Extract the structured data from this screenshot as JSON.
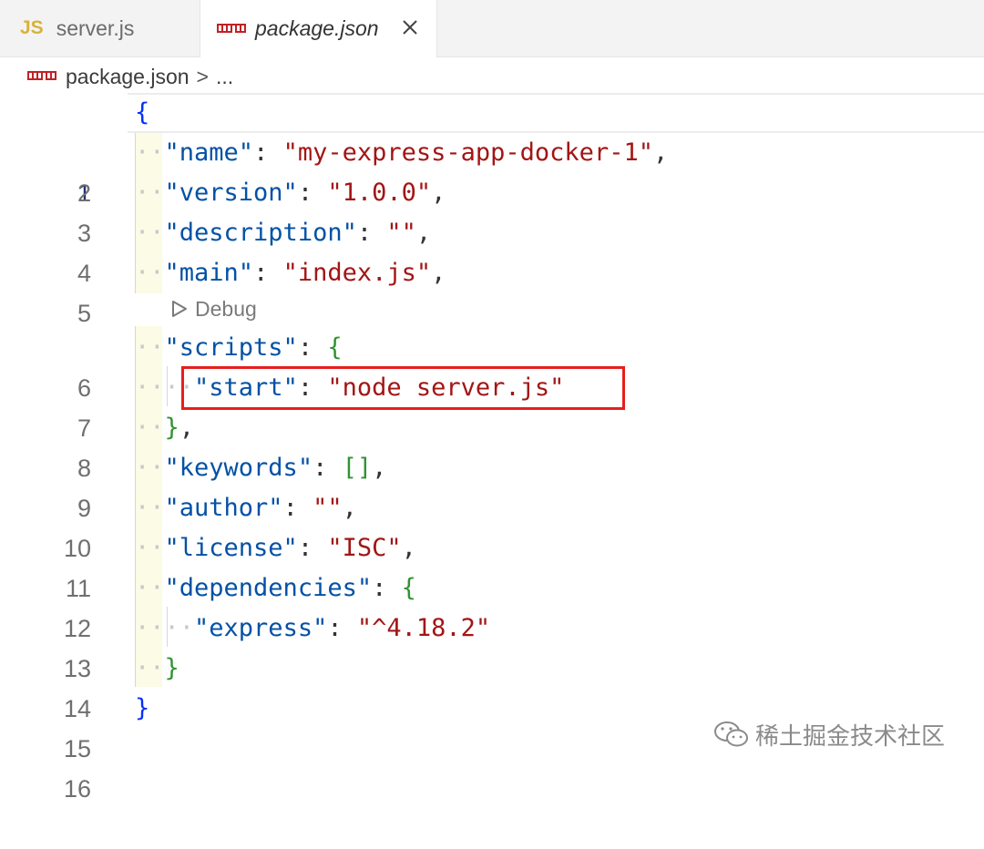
{
  "tabs": [
    {
      "icon": "js-icon",
      "icon_text": "JS",
      "label": "server.js",
      "active": false
    },
    {
      "icon": "npm-icon",
      "label": "package.json",
      "active": true
    }
  ],
  "breadcrumb": {
    "file": "package.json",
    "separator": ">",
    "tail": "..."
  },
  "codelens": {
    "label": "Debug"
  },
  "line_numbers": [
    "1",
    "2",
    "3",
    "4",
    "5",
    "6",
    "7",
    "8",
    "9",
    "10",
    "11",
    "12",
    "13",
    "14",
    "15",
    "16"
  ],
  "code": {
    "l1_open": "{",
    "name_key": "\"name\"",
    "name_val": "\"my-express-app-docker-1\"",
    "version_key": "\"version\"",
    "version_val": "\"1.0.0\"",
    "description_key": "\"description\"",
    "description_val": "\"\"",
    "main_key": "\"main\"",
    "main_val": "\"index.js\"",
    "scripts_key": "\"scripts\"",
    "start_key": "\"start\"",
    "start_val": "\"node server.js\"",
    "keywords_key": "\"keywords\"",
    "author_key": "\"author\"",
    "author_val": "\"\"",
    "license_key": "\"license\"",
    "license_val": "\"ISC\"",
    "dependencies_key": "\"dependencies\"",
    "express_key": "\"express\"",
    "express_val": "\"^4.18.2\"",
    "l15_close": "}"
  },
  "watermark": {
    "text": "稀土掘金技术社区"
  },
  "colors": {
    "key": "#0451a5",
    "string": "#a31515",
    "brace_outer": "#0431fa",
    "brace_inner": "#319331",
    "highlight_border": "#e81e1e"
  }
}
